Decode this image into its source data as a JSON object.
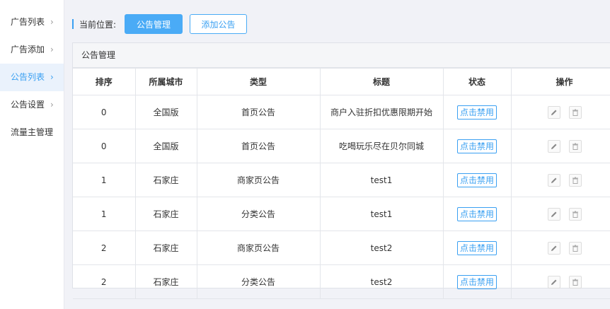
{
  "sidebar": {
    "items": [
      {
        "label": "广告列表",
        "chevron": "›"
      },
      {
        "label": "广告添加",
        "chevron": "›"
      },
      {
        "label": "公告列表",
        "chevron": "›"
      },
      {
        "label": "公告设置",
        "chevron": "›"
      },
      {
        "label": "流量主管理",
        "chevron": ""
      }
    ]
  },
  "topbar": {
    "location_label": "当前位置:",
    "manage_button": "公告管理",
    "add_button": "添加公告"
  },
  "panel": {
    "title": "公告管理",
    "columns": [
      "排序",
      "所属城市",
      "类型",
      "标题",
      "状态",
      "操作"
    ],
    "rows": [
      {
        "sort": "0",
        "city": "全国版",
        "type": "首页公告",
        "title": "商户入驻折扣优惠限期开始",
        "status": "点击禁用"
      },
      {
        "sort": "0",
        "city": "全国版",
        "type": "首页公告",
        "title": "吃喝玩乐尽在贝尔同城",
        "status": "点击禁用"
      },
      {
        "sort": "1",
        "city": "石家庄",
        "type": "商家页公告",
        "title": "test1",
        "status": "点击禁用"
      },
      {
        "sort": "1",
        "city": "石家庄",
        "type": "分类公告",
        "title": "test1",
        "status": "点击禁用"
      },
      {
        "sort": "2",
        "city": "石家庄",
        "type": "商家页公告",
        "title": "test2",
        "status": "点击禁用"
      },
      {
        "sort": "2",
        "city": "石家庄",
        "type": "分类公告",
        "title": "test2",
        "status": "点击禁用"
      }
    ]
  },
  "colors": {
    "accent": "#3aa0f2",
    "sidebar_active_bg": "#eaf2fc",
    "page_bg": "#f1f2f7"
  },
  "icons": {
    "edit": "edit-icon",
    "delete": "delete-icon",
    "chevron": "chevron-right-icon"
  }
}
